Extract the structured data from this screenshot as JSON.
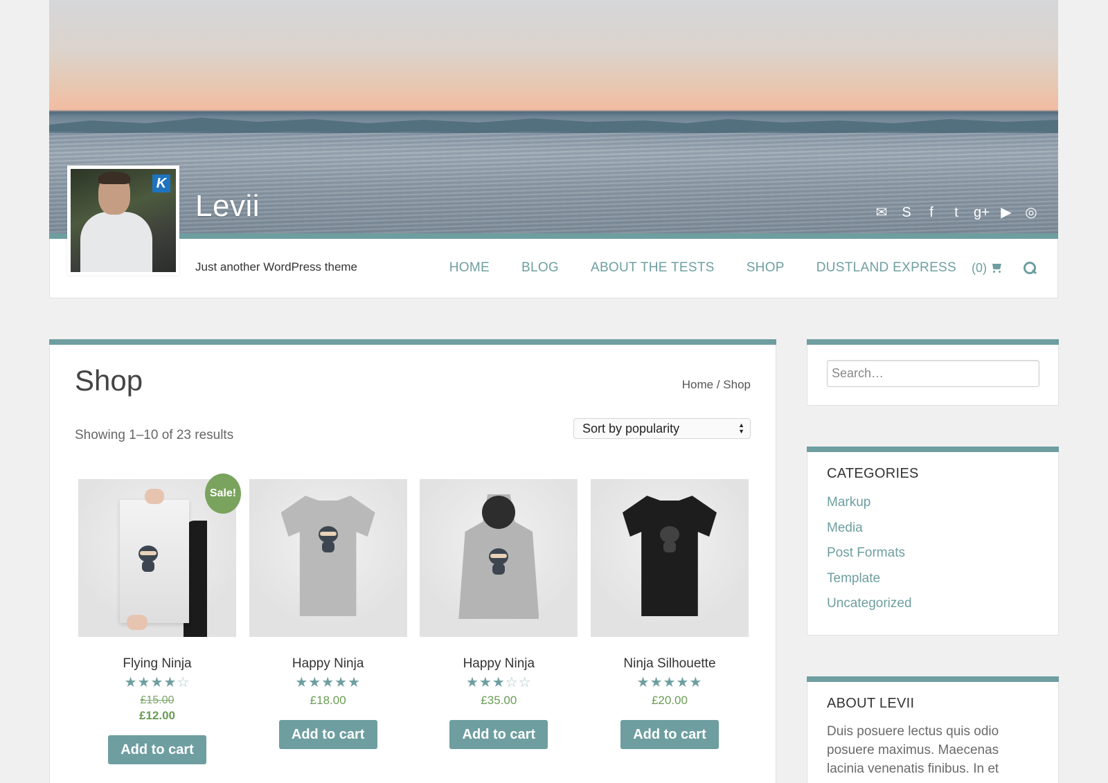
{
  "site": {
    "title": "Levii",
    "tagline": "Just another WordPress theme",
    "avatar_badge": "K"
  },
  "social_icons": [
    "mail-icon",
    "skype-icon",
    "facebook-icon",
    "twitter-icon",
    "google-plus-icon",
    "youtube-icon",
    "instagram-icon"
  ],
  "social_glyphs": {
    "mail": "✉",
    "skype": "S",
    "facebook": "f",
    "twitter": "t",
    "gplus": "g+",
    "youtube": "▶",
    "instagram": "◎"
  },
  "nav": {
    "items": [
      "HOME",
      "BLOG",
      "ABOUT THE TESTS",
      "SHOP",
      "DUSTLAND EXPRESS"
    ],
    "cart_count": "(0)"
  },
  "shop": {
    "title": "Shop",
    "breadcrumb": {
      "home": "Home",
      "sep": " / ",
      "current": "Shop"
    },
    "result_count": "Showing 1–10 of 23 results",
    "sort_selected": "Sort by popularity",
    "products": [
      {
        "name": "Flying Ninja",
        "rating": 4,
        "price_old": "£15.00",
        "price": "£12.00",
        "sale": "Sale!",
        "button": "Add to cart"
      },
      {
        "name": "Happy Ninja",
        "rating": 5,
        "price": "£18.00",
        "button": "Add to cart"
      },
      {
        "name": "Happy Ninja",
        "rating": 3,
        "price": "£35.00",
        "button": "Add to cart"
      },
      {
        "name": "Ninja Silhouette",
        "rating": 5,
        "price": "£20.00",
        "button": "Add to cart"
      }
    ]
  },
  "sidebar": {
    "search_placeholder": "Search…",
    "categories_title": "CATEGORIES",
    "categories": [
      "Markup",
      "Media",
      "Post Formats",
      "Template",
      "Uncategorized"
    ],
    "about_title": "ABOUT LEVII",
    "about_text": "Duis posuere lectus quis odio posuere maximus. Maecenas lacinia venenatis finibus. In et"
  },
  "colors": {
    "accent": "#6e9ea0",
    "sale": "#7aa35e",
    "price": "#6a9c55"
  }
}
